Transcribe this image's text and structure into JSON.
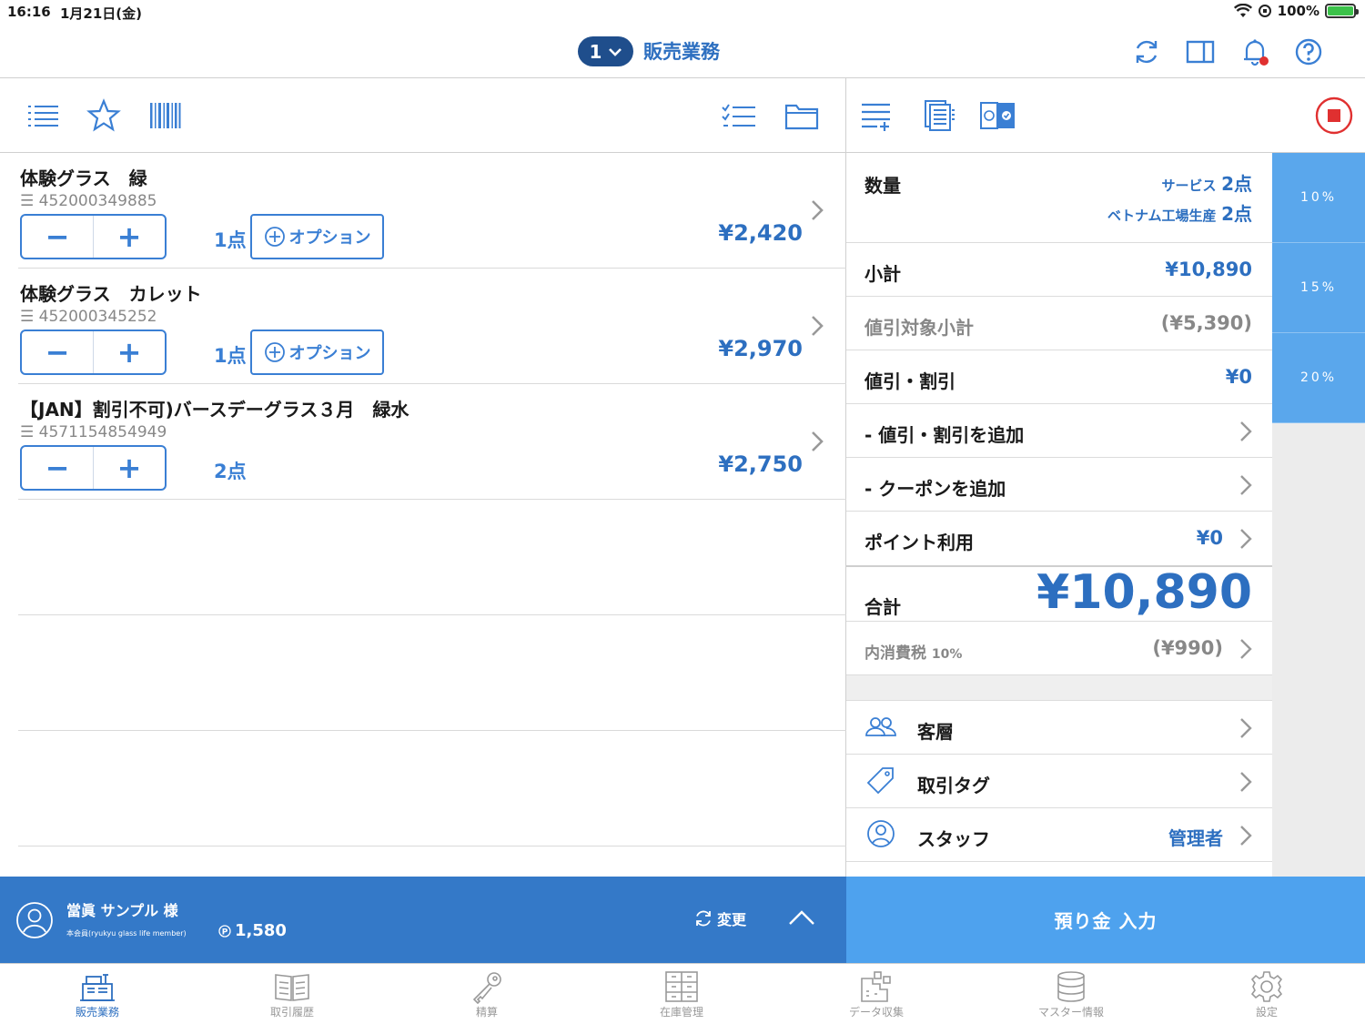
{
  "status": {
    "time": "16:16",
    "date": "1月21日(金)",
    "battery": "100%"
  },
  "nav": {
    "register_no": "1",
    "title": "販売業務"
  },
  "items": [
    {
      "name": "体験グラス　緑",
      "code": "452000349885",
      "qty": "1点",
      "option": "オプション",
      "price": "¥2,420"
    },
    {
      "name": "体験グラス　カレット",
      "code": "452000345252",
      "qty": "1点",
      "option": "オプション",
      "price": "¥2,970"
    },
    {
      "name": "【JAN】割引不可)バースデーグラス３月　緑水",
      "code": "4571154854949",
      "qty": "2点",
      "price": "¥2,750"
    }
  ],
  "summary": {
    "quantity_label": "数量",
    "qty_service_label": "サービス",
    "qty_service_value": "2点",
    "qty_vietnam_label": "ベトナム工場生産",
    "qty_vietnam_value": "2点",
    "subtotal_label": "小計",
    "subtotal_value": "¥10,890",
    "discount_target_label": "値引対象小計",
    "discount_target_value": "(¥5,390)",
    "discount_label": "値引・割引",
    "discount_value": "¥0",
    "add_discount_label": "- 値引・割引を追加",
    "add_coupon_label": "- クーポンを追加",
    "points_label": "ポイント利用",
    "points_value": "¥0",
    "total_label": "合計",
    "total_value": "¥10,890",
    "tax_label": "内消費税",
    "tax_rate": "10%",
    "tax_value": "(¥990)",
    "customer_layer_label": "客層",
    "trade_tag_label": "取引タグ",
    "staff_label": "スタッフ",
    "staff_value": "管理者"
  },
  "rates": [
    "10%",
    "15%",
    "20%"
  ],
  "member": {
    "name": "當眞 サンプル 様",
    "rank": "本会員(ryukyu glass life member)",
    "points": "1,580",
    "change_label": "変更"
  },
  "deposit_label": "預り金 入力",
  "tabs": [
    {
      "label": "販売業務",
      "icon": "register-icon"
    },
    {
      "label": "取引履歴",
      "icon": "history-icon"
    },
    {
      "label": "精算",
      "icon": "key-icon"
    },
    {
      "label": "在庫管理",
      "icon": "inventory-icon"
    },
    {
      "label": "データ収集",
      "icon": "data-collection-icon"
    },
    {
      "label": "マスター情報",
      "icon": "database-icon"
    },
    {
      "label": "設定",
      "icon": "gear-icon"
    }
  ],
  "colors": {
    "primary": "#2d6fc0",
    "member_bar": "#3479c8",
    "deposit": "#4ea2ee",
    "rate_tile": "#5aa7ec",
    "nav_pill": "#1f4e8c"
  }
}
